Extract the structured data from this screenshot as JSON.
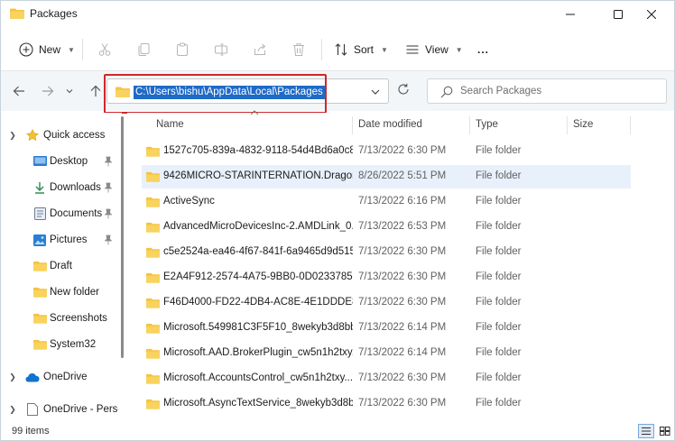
{
  "window": {
    "title": "Packages"
  },
  "toolbar": {
    "new_label": "New",
    "sort_label": "Sort",
    "view_label": "View",
    "more_label": "..."
  },
  "address": {
    "path": "C:\\Users\\bishu\\AppData\\Local\\Packages"
  },
  "search": {
    "placeholder": "Search Packages"
  },
  "sidebar": {
    "items": [
      {
        "label": "Quick access",
        "icon": "star-icon"
      },
      {
        "label": "Desktop",
        "icon": "desktop-icon"
      },
      {
        "label": "Downloads",
        "icon": "download-icon"
      },
      {
        "label": "Documents",
        "icon": "documents-icon"
      },
      {
        "label": "Pictures",
        "icon": "pictures-icon"
      },
      {
        "label": "Draft",
        "icon": "folder-icon"
      },
      {
        "label": "New folder",
        "icon": "folder-icon"
      },
      {
        "label": "Screenshots",
        "icon": "folder-icon"
      },
      {
        "label": "System32",
        "icon": "folder-icon"
      },
      {
        "label": "OneDrive",
        "icon": "cloud-icon"
      },
      {
        "label": "OneDrive - Perso",
        "icon": "document-icon"
      }
    ]
  },
  "columns": {
    "name": "Name",
    "date": "Date modified",
    "type": "Type",
    "size": "Size"
  },
  "files": [
    {
      "name": "1527c705-839a-4832-9118-54d4Bd6a0c89...",
      "date": "7/13/2022 6:30 PM",
      "type": "File folder"
    },
    {
      "name": "9426MICRO-STARINTERNATION.DragonC...",
      "date": "8/26/2022 5:51 PM",
      "type": "File folder"
    },
    {
      "name": "ActiveSync",
      "date": "7/13/2022 6:16 PM",
      "type": "File folder"
    },
    {
      "name": "AdvancedMicroDevicesInc-2.AMDLink_0...",
      "date": "7/13/2022 6:53 PM",
      "type": "File folder"
    },
    {
      "name": "c5e2524a-ea46-4f67-841f-6a9465d9d515_...",
      "date": "7/13/2022 6:30 PM",
      "type": "File folder"
    },
    {
      "name": "E2A4F912-2574-4A75-9BB0-0D023378592...",
      "date": "7/13/2022 6:30 PM",
      "type": "File folder"
    },
    {
      "name": "F46D4000-FD22-4DB4-AC8E-4E1DDDE828...",
      "date": "7/13/2022 6:30 PM",
      "type": "File folder"
    },
    {
      "name": "Microsoft.549981C3F5F10_8wekyb3d8bb...",
      "date": "7/13/2022 6:14 PM",
      "type": "File folder"
    },
    {
      "name": "Microsoft.AAD.BrokerPlugin_cw5n1h2txy...",
      "date": "7/13/2022 6:14 PM",
      "type": "File folder"
    },
    {
      "name": "Microsoft.AccountsControl_cw5n1h2txy...",
      "date": "7/13/2022 6:30 PM",
      "type": "File folder"
    },
    {
      "name": "Microsoft.AsyncTextService_8wekyb3d8b...",
      "date": "7/13/2022 6:30 PM",
      "type": "File folder"
    }
  ],
  "status": {
    "item_count": "99 items"
  },
  "colors": {
    "folder": "#f5c342",
    "selection": "#1e6ac6",
    "highlight_box": "#d0262a",
    "selected_row": "#e8f1fb"
  }
}
